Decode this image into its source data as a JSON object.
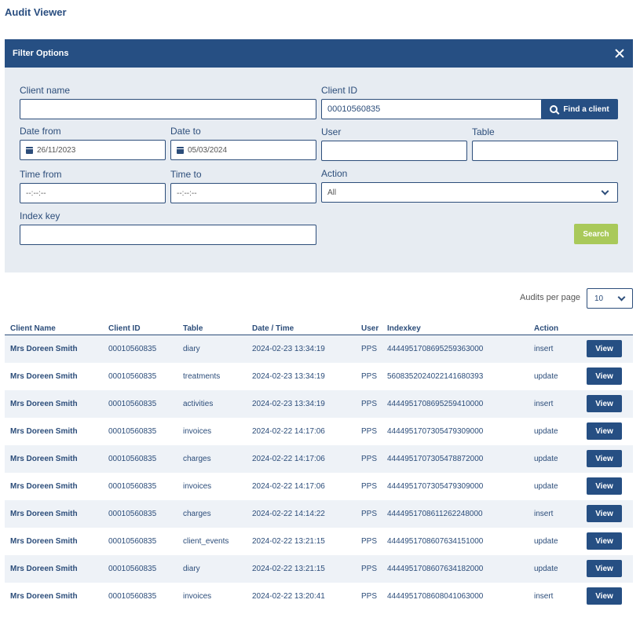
{
  "page_title": "Audit Viewer",
  "filter": {
    "title": "Filter Options",
    "client_name_label": "Client name",
    "client_name_value": "",
    "client_id_label": "Client ID",
    "client_id_value": "00010560835",
    "find_client_label": "Find a client",
    "date_from_label": "Date from",
    "date_from_value": "26/11/2023",
    "date_to_label": "Date to",
    "date_to_value": "05/03/2024",
    "user_label": "User",
    "user_value": "",
    "table_label": "Table",
    "table_value": "",
    "time_from_label": "Time from",
    "time_from_value": "--:--:--",
    "time_to_label": "Time to",
    "time_to_value": "--:--:--",
    "action_label": "Action",
    "action_value": "All",
    "index_key_label": "Index key",
    "index_key_value": "",
    "search_label": "Search"
  },
  "pagination": {
    "label": "Audits per page",
    "value": "10"
  },
  "table": {
    "columns": [
      "Client Name",
      "Client ID",
      "Table",
      "Date / Time",
      "User",
      "Indexkey",
      "Action"
    ],
    "view_label": "View",
    "rows": [
      [
        "Mrs Doreen Smith",
        "00010560835",
        "diary",
        "2024-02-23 13:34:19",
        "PPS",
        "444495170869525936​3000",
        "insert"
      ],
      [
        "Mrs Doreen Smith",
        "00010560835",
        "treatments",
        "2024-02-23 13:34:19",
        "PPS",
        "5608352024022141680393",
        "update"
      ],
      [
        "Mrs Doreen Smith",
        "00010560835",
        "activities",
        "2024-02-23 13:34:19",
        "PPS",
        "4444951708695259410000",
        "insert"
      ],
      [
        "Mrs Doreen Smith",
        "00010560835",
        "invoices",
        "2024-02-22 14:17:06",
        "PPS",
        "4444951707305479309000",
        "update"
      ],
      [
        "Mrs Doreen Smith",
        "00010560835",
        "charges",
        "2024-02-22 14:17:06",
        "PPS",
        "4444951707305478872000",
        "update"
      ],
      [
        "Mrs Doreen Smith",
        "00010560835",
        "invoices",
        "2024-02-22 14:17:06",
        "PPS",
        "4444951707305479309000",
        "update"
      ],
      [
        "Mrs Doreen Smith",
        "00010560835",
        "charges",
        "2024-02-22 14:14:22",
        "PPS",
        "4444951708611262248000",
        "insert"
      ],
      [
        "Mrs Doreen Smith",
        "00010560835",
        "client_events",
        "2024-02-22 13:21:15",
        "PPS",
        "4444951708607634151000",
        "update"
      ],
      [
        "Mrs Doreen Smith",
        "00010560835",
        "diary",
        "2024-02-22 13:21:15",
        "PPS",
        "4444951708607634182000",
        "update"
      ],
      [
        "Mrs Doreen Smith",
        "00010560835",
        "invoices",
        "2024-02-22 13:20:41",
        "PPS",
        "4444951708608041063000",
        "insert"
      ]
    ]
  }
}
